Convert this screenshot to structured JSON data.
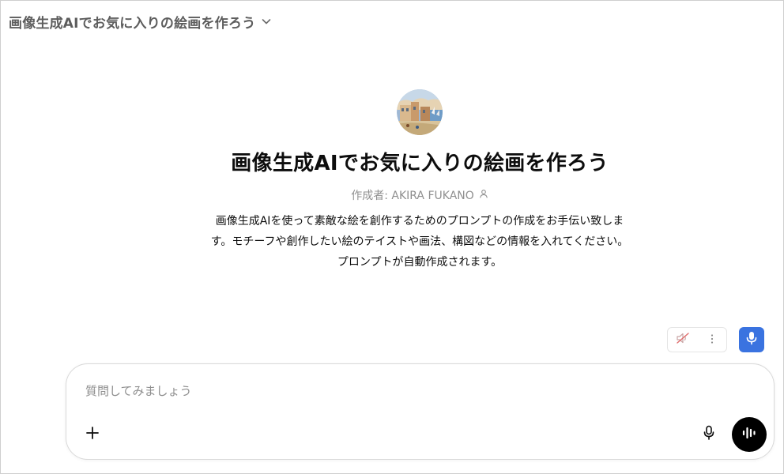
{
  "header": {
    "title": "画像生成AIでお気に入りの絵画を作ろう",
    "dropdown_icon": "chevron-down-icon"
  },
  "gpt": {
    "avatar_icon": "painting-thumbnail",
    "title": "画像生成AIでお気に入りの絵画を作ろう",
    "author": "作成者: AKIRA FUKANO",
    "author_icon": "person-icon",
    "description": "画像生成AIを使って素敵な絵を創作するためのプロンプトの作成をお手伝い致します。モチーフや創作したい絵のテイストや画法、構図などの情報を入れてください。プロンプトが自動作成されます。"
  },
  "toolbar": {
    "mute_icon": "speaker-muted-icon",
    "more_icon": "more-vertical-icon",
    "voice_icon": "microphone-icon"
  },
  "composer": {
    "value": "",
    "placeholder": "質問してみましょう",
    "attach_icon": "plus-icon",
    "dictate_icon": "microphone-icon",
    "voice_mode_icon": "waveform-icon"
  },
  "colors": {
    "accent": "#3a73e0",
    "text": "#0d0d0d",
    "muted": "#8f8f8f",
    "send_button": "#000000"
  }
}
